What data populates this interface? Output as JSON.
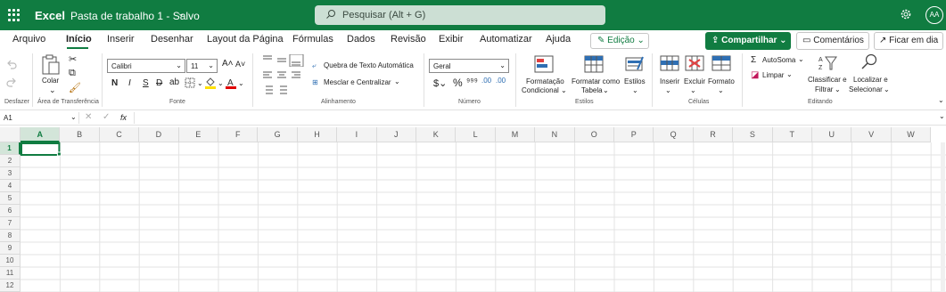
{
  "app": {
    "name": "Excel",
    "doc_title": "Pasta de trabalho 1 - Salvo",
    "search_placeholder": "Pesquisar (Alt + G)",
    "user_initials": "AA"
  },
  "tabs": [
    "Arquivo",
    "Início",
    "Inserir",
    "Desenhar",
    "Layout da Página",
    "Fórmulas",
    "Dados",
    "Revisão",
    "Exibir",
    "Automatizar",
    "Ajuda"
  ],
  "active_tab": "Início",
  "actions": {
    "edit": "Edição",
    "share": "Compartilhar",
    "comments": "Comentários",
    "stay": "Ficar em dia"
  },
  "ribbon": {
    "undo_group": "Desfazer",
    "paste": "Colar",
    "clipboard_group": "Área de Transferência",
    "font_name": "Calibri",
    "font_size": "11",
    "bold": "N",
    "italic": "I",
    "underline": "S",
    "strike": "D",
    "font_group": "Fonte",
    "wrap_text": "Quebra de Texto Automática",
    "merge_center": "Mesclar e Centralizar",
    "alignment_group": "Alinhamento",
    "number_format": "Geral",
    "number_group": "Número",
    "cond_format_1": "Formatação",
    "cond_format_2": "Condicional",
    "format_table_1": "Formatar como",
    "format_table_2": "Tabela",
    "styles_btn": "Estilos",
    "styles_group": "Estilos",
    "insert": "Inserir",
    "delete": "Excluir",
    "format": "Formato",
    "cells_group": "Células",
    "autosum": "AutoSoma",
    "clear": "Limpar",
    "sort_1": "Classificar e",
    "sort_2": "Filtrar",
    "find_1": "Localizar e",
    "find_2": "Selecionar",
    "editing_group": "Editando"
  },
  "formula_bar": {
    "name_box": "A1",
    "fx": "fx",
    "value": ""
  },
  "grid": {
    "columns": [
      "A",
      "B",
      "C",
      "D",
      "E",
      "F",
      "G",
      "H",
      "I",
      "J",
      "K",
      "L",
      "M",
      "N",
      "O",
      "P",
      "Q",
      "R",
      "S",
      "T",
      "U",
      "V",
      "W"
    ],
    "rows": [
      "1",
      "2",
      "3",
      "4",
      "5",
      "6",
      "7",
      "8",
      "9",
      "10",
      "11",
      "12"
    ],
    "selected_cell": "A1",
    "accent": "#107c41"
  }
}
